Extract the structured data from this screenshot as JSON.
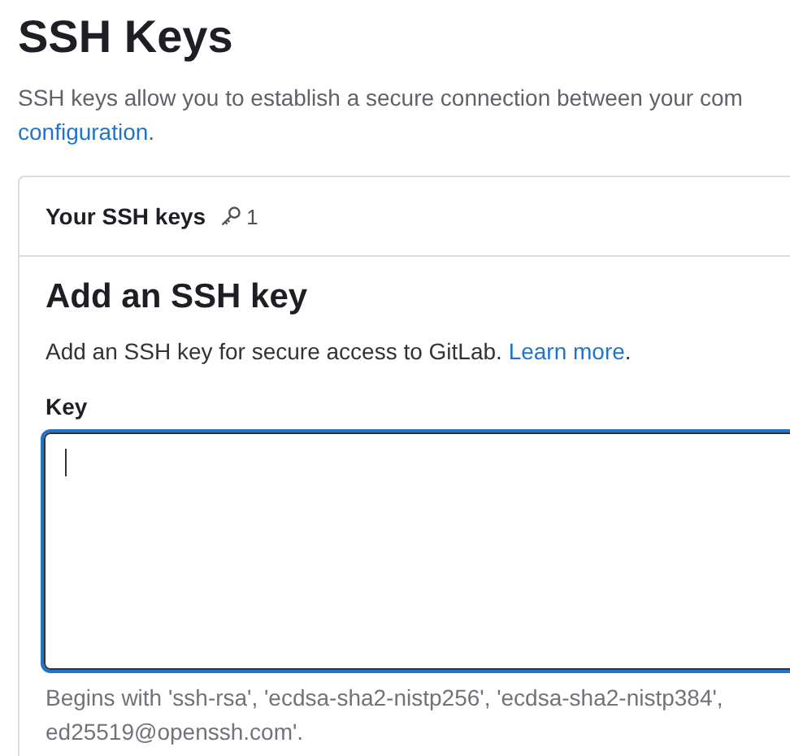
{
  "page": {
    "title": "SSH Keys",
    "description": {
      "text": "SSH keys allow you to establish a secure connection between your com",
      "link": "configuration",
      "after_link": "."
    }
  },
  "card": {
    "title": "Your SSH keys",
    "count": "1",
    "form": {
      "heading": "Add an SSH key",
      "text": "Add an SSH key for secure access to GitLab.",
      "link": "Learn more",
      "after_link": ".",
      "field": {
        "label": "Key",
        "focused": true
      },
      "help_lines": [
        "Begins with 'ssh-rsa', 'ecdsa-sha2-nistp256', 'ecdsa-sha2-nistp384',",
        "ed25519@openssh.com'."
      ]
    }
  }
}
